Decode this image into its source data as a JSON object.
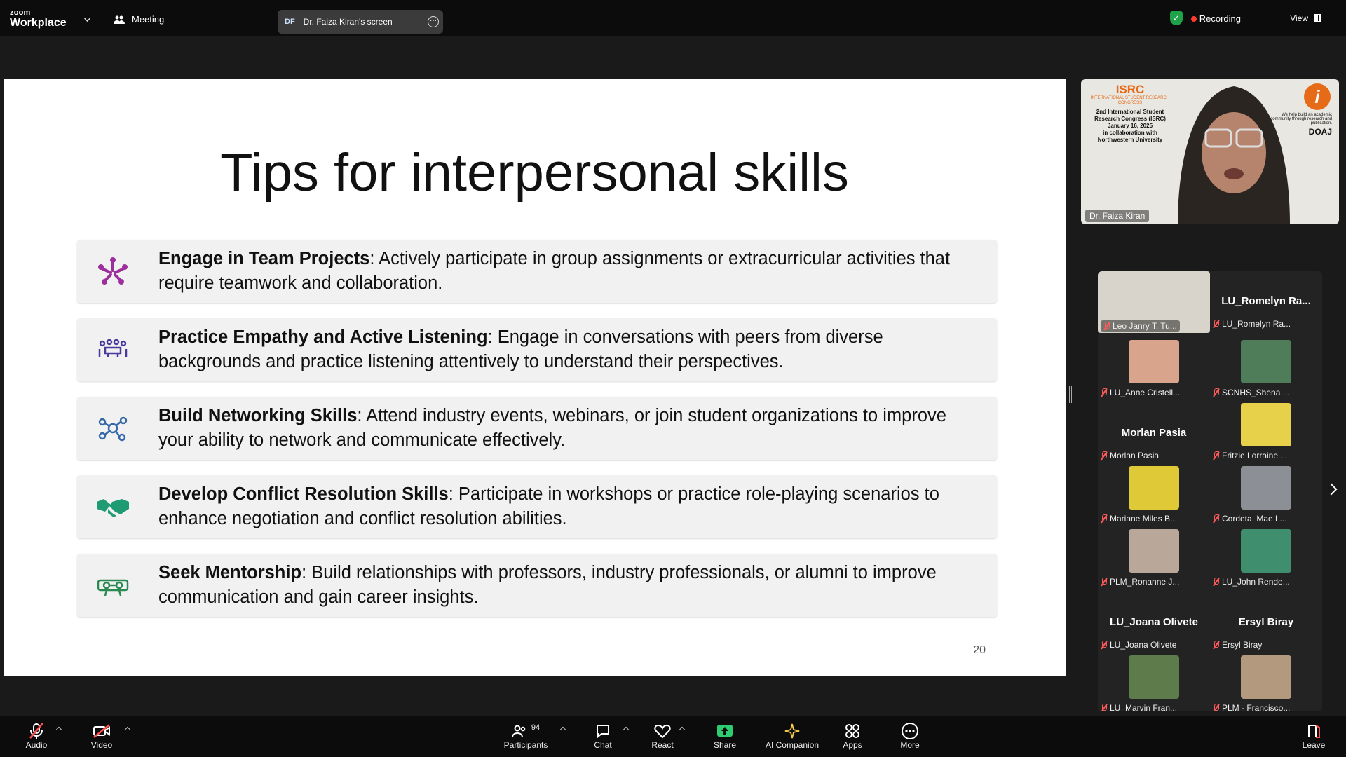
{
  "topbar": {
    "logo_line1": "zoom",
    "logo_line2": "Workplace",
    "meeting_label": "Meeting",
    "screen_initials": "DF",
    "screen_label": "Dr. Faiza Kiran's screen",
    "recording_label": "Recording",
    "view_label": "View"
  },
  "slide": {
    "title": "Tips for interpersonal skills",
    "page_number": "20",
    "tips": [
      {
        "icon": "team-icon",
        "heading": "Engage in Team Projects",
        "text": ": Actively participate in group assignments or extracurricular activities that require teamwork and collaboration."
      },
      {
        "icon": "meeting-table-icon",
        "heading": "Practice Empathy and Active Listening",
        "text": ": Engage in conversations with peers from diverse backgrounds and practice listening attentively to understand their perspectives."
      },
      {
        "icon": "network-icon",
        "heading": "Build Networking Skills",
        "text": ": Attend industry events, webinars, or join student organizations to improve your ability to network and communicate effectively."
      },
      {
        "icon": "handshake-icon",
        "heading": "Develop Conflict Resolution Skills",
        "text": ": Participate in workshops or practice role-playing scenarios to enhance negotiation and conflict resolution abilities."
      },
      {
        "icon": "mentorship-icon",
        "heading": "Seek Mentorship",
        "text": ": Build relationships with professors, industry professionals, or alumni to improve communication and gain career insights."
      }
    ]
  },
  "speaker": {
    "name": "Dr. Faiza Kiran",
    "bg_isrc": "ISRC",
    "bg_sub": "INTERNATIONAL STUDENT RESEARCH CONGRESS",
    "bg_line1": "2nd International Student Research Congress (ISRC)",
    "bg_line2": "January 16, 2025",
    "bg_line3": "in collaboration with Northwestern University",
    "bg_tagline": "We help build an academic community through research and publication.",
    "bg_doaj": "DOAJ"
  },
  "gallery": {
    "tiles": [
      {
        "label": "Leo Janry T. Tu...",
        "big": "",
        "color": "#c9c4bc"
      },
      {
        "label": "LU_Romelyn Ra...",
        "big": "LU_Romelyn Ra...",
        "color": ""
      },
      {
        "label": "LU_Anne Cristell...",
        "big": "",
        "color": "#d8a58c"
      },
      {
        "label": "SCNHS_Shena ...",
        "big": "",
        "color": "#4f7d5a"
      },
      {
        "label": "Morlan Pasia",
        "big": "Morlan Pasia",
        "color": ""
      },
      {
        "label": "Fritzie Lorraine ...",
        "big": "",
        "color": "#e7d04a"
      },
      {
        "label": "Mariane Miles B...",
        "big": "",
        "color": "#e0c936"
      },
      {
        "label": "Cordeta, Mae L...",
        "big": "",
        "color": "#8c8f95"
      },
      {
        "label": "PLM_Ronanne J...",
        "big": "",
        "color": "#b9a79a"
      },
      {
        "label": "LU_John Rende...",
        "big": "",
        "color": "#3f8e6e"
      },
      {
        "label": "LU_Joana Olivete",
        "big": "LU_Joana Olivete",
        "color": ""
      },
      {
        "label": "Ersyl Biray",
        "big": "Ersyl Biray",
        "color": ""
      },
      {
        "label": "LU_Marvin Fran...",
        "big": "",
        "color": "#5e7b4c"
      },
      {
        "label": "PLM - Francisco...",
        "big": "",
        "color": "#b39a7e"
      }
    ]
  },
  "bottombar": {
    "audio": "Audio",
    "video": "Video",
    "participants": "Participants",
    "participants_count": "94",
    "chat": "Chat",
    "react": "React",
    "share": "Share",
    "ai": "AI Companion",
    "apps": "Apps",
    "more": "More",
    "leave": "Leave"
  }
}
